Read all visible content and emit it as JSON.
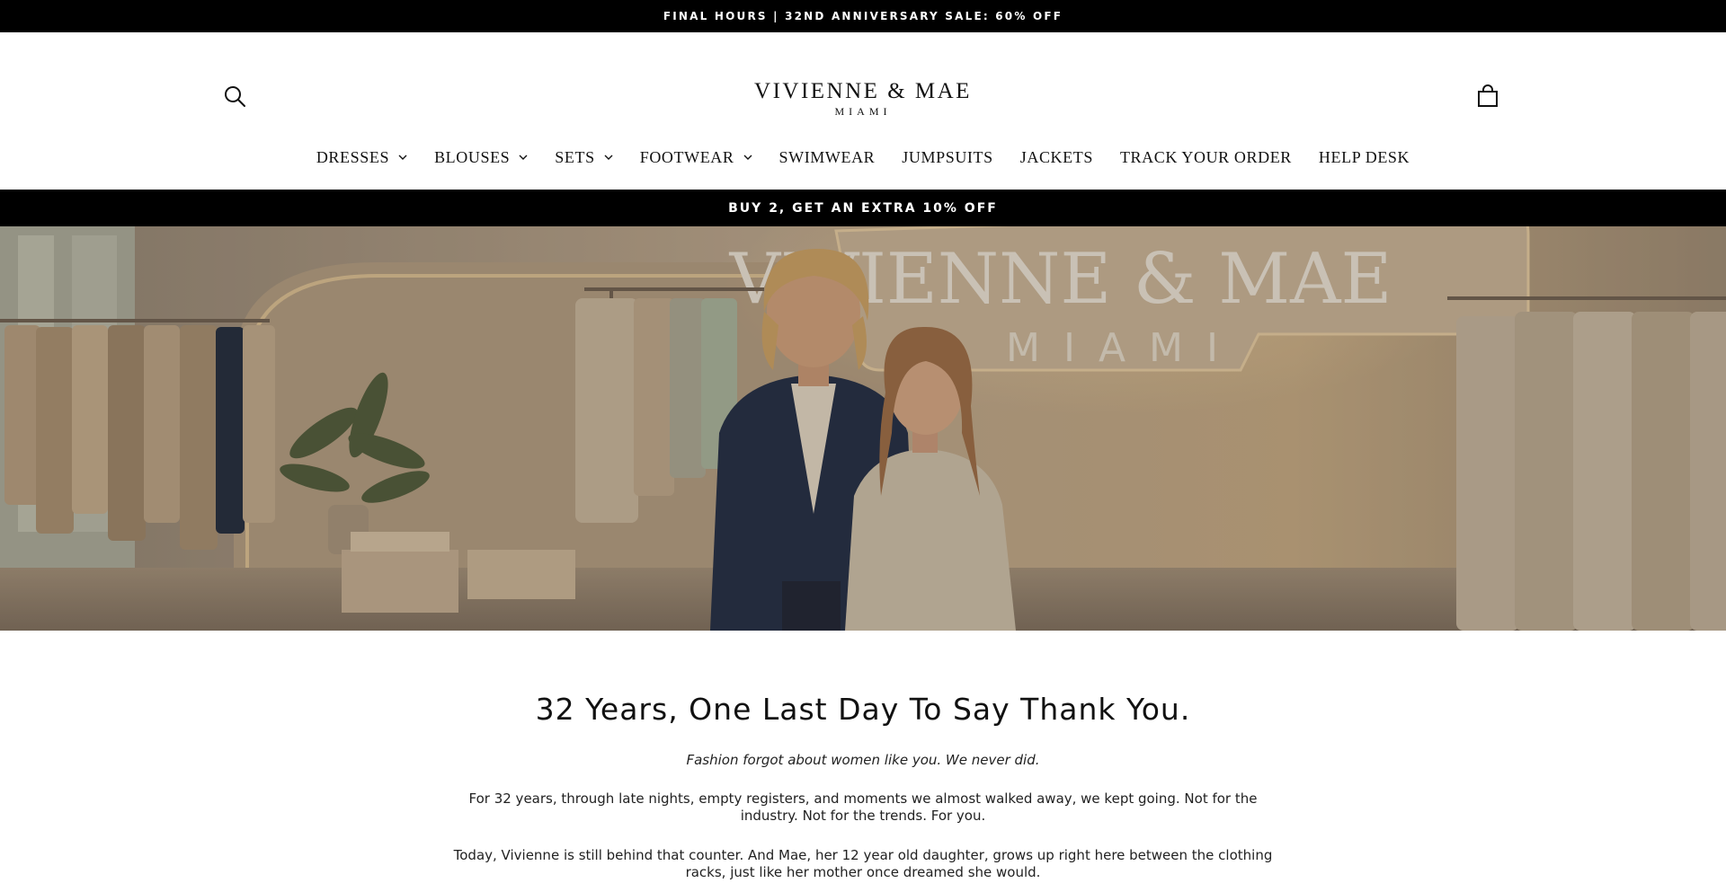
{
  "announcement": {
    "text": "FINAL HOURS | 32ND ANNIVERSARY SALE: 60% OFF"
  },
  "header": {
    "logo_main": "VIVIENNE & MAE",
    "logo_sub": "MIAMI",
    "search_icon": "search-icon",
    "cart_icon": "shopping-bag-icon"
  },
  "nav": {
    "items": [
      {
        "label": "DRESSES",
        "has_dropdown": true
      },
      {
        "label": "BLOUSES",
        "has_dropdown": true
      },
      {
        "label": "SETS",
        "has_dropdown": true
      },
      {
        "label": "FOOTWEAR",
        "has_dropdown": true
      },
      {
        "label": "SWIMWEAR",
        "has_dropdown": false
      },
      {
        "label": "JUMPSUITS",
        "has_dropdown": false
      },
      {
        "label": "JACKETS",
        "has_dropdown": false
      },
      {
        "label": "TRACK YOUR ORDER",
        "has_dropdown": false
      },
      {
        "label": "HELP DESK",
        "has_dropdown": false
      }
    ]
  },
  "promo": {
    "text": "BUY 2, GET AN EXTRA 10% OFF"
  },
  "hero": {
    "sign_main": "VIVIENNE & MAE",
    "sign_sub": "MIAMI"
  },
  "story": {
    "headline": "32 Years, One Last Day To Say Thank You.",
    "subline": "Fashion forgot about women like you. We never did.",
    "paragraph1": "For 32 years, through late nights, empty registers, and moments we almost walked away, we kept going. Not for the industry. Not for the trends. For you.",
    "paragraph2": "Today, Vivienne is still behind that counter. And Mae, her 12 year old daughter, grows up right here between the clothing racks, just like her mother once dreamed she would."
  },
  "colors": {
    "bar_background": "#000000",
    "bar_text": "#ffffff",
    "text": "#111111",
    "hero_warm": "#b8a48a"
  }
}
